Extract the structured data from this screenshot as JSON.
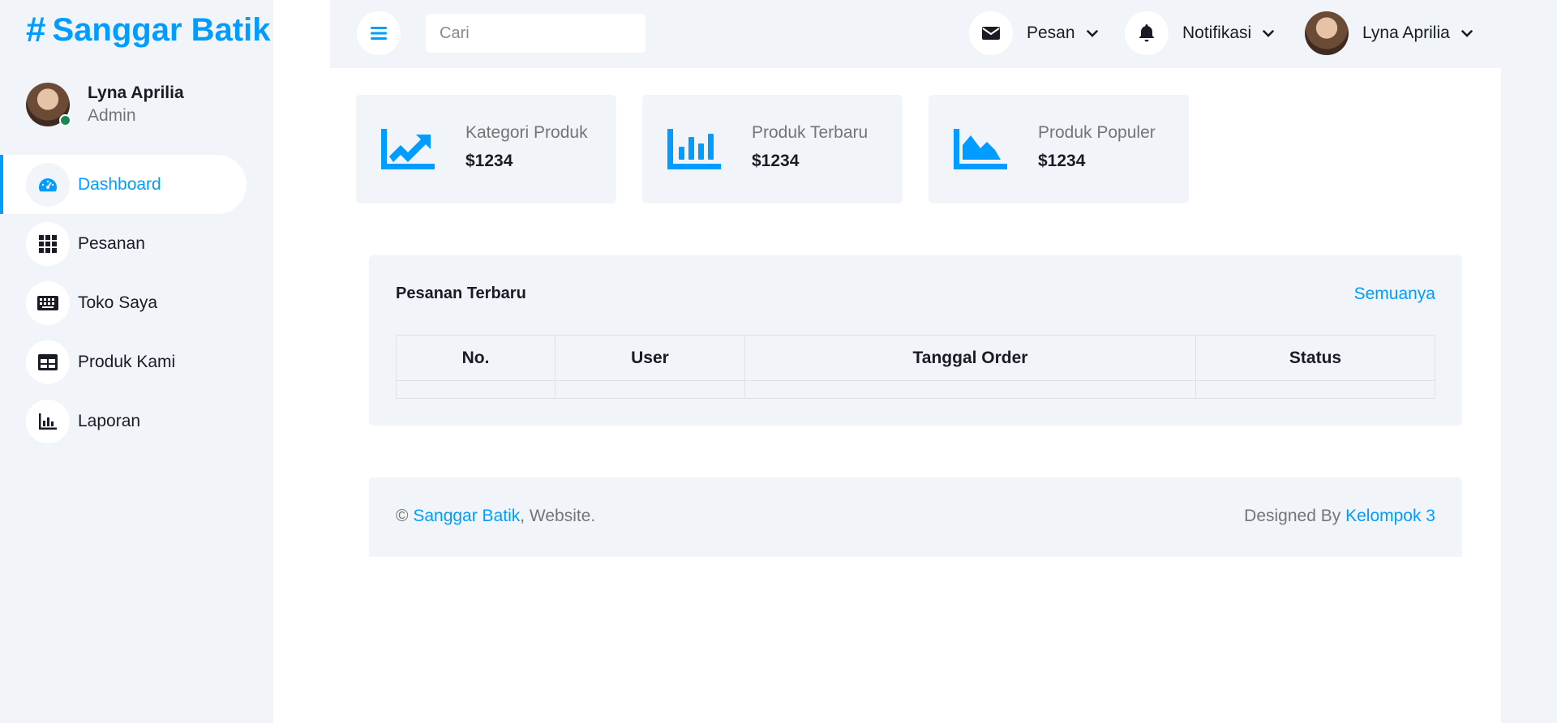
{
  "brand": {
    "symbol": "#",
    "name": "Sanggar Batik"
  },
  "profile": {
    "name": "Lyna Aprilia",
    "role": "Admin"
  },
  "sidebar": {
    "items": [
      {
        "label": "Dashboard",
        "icon": "gauge-icon",
        "active": true
      },
      {
        "label": "Pesanan",
        "icon": "grid-icon"
      },
      {
        "label": "Toko Saya",
        "icon": "keyboard-icon"
      },
      {
        "label": "Produk Kami",
        "icon": "table-icon"
      },
      {
        "label": "Laporan",
        "icon": "bar-chart-icon"
      }
    ]
  },
  "topbar": {
    "search_placeholder": "Cari",
    "messages_label": "Pesan",
    "notifications_label": "Notifikasi",
    "user_label": "Lyna Aprilia"
  },
  "stats": [
    {
      "label": "Kategori Produk",
      "value": "$1234",
      "icon": "chart-line-icon"
    },
    {
      "label": "Produk Terbaru",
      "value": "$1234",
      "icon": "chart-bar-icon"
    },
    {
      "label": "Produk Populer",
      "value": "$1234",
      "icon": "chart-area-icon"
    }
  ],
  "orders": {
    "title": "Pesanan Terbaru",
    "link": "Semuanya",
    "columns": [
      "No.",
      "User",
      "Tanggal Order",
      "Status"
    ]
  },
  "footer": {
    "copyright_symbol": "©",
    "site_link": "Sanggar Batik",
    "site_suffix": ", Website.",
    "designed_prefix": "Designed By",
    "designer_link": "Kelompok 3"
  },
  "colors": {
    "accent": "#009cff",
    "background": "#f1f4f8",
    "text": "#191c24",
    "muted": "#757575",
    "online": "#198754"
  }
}
